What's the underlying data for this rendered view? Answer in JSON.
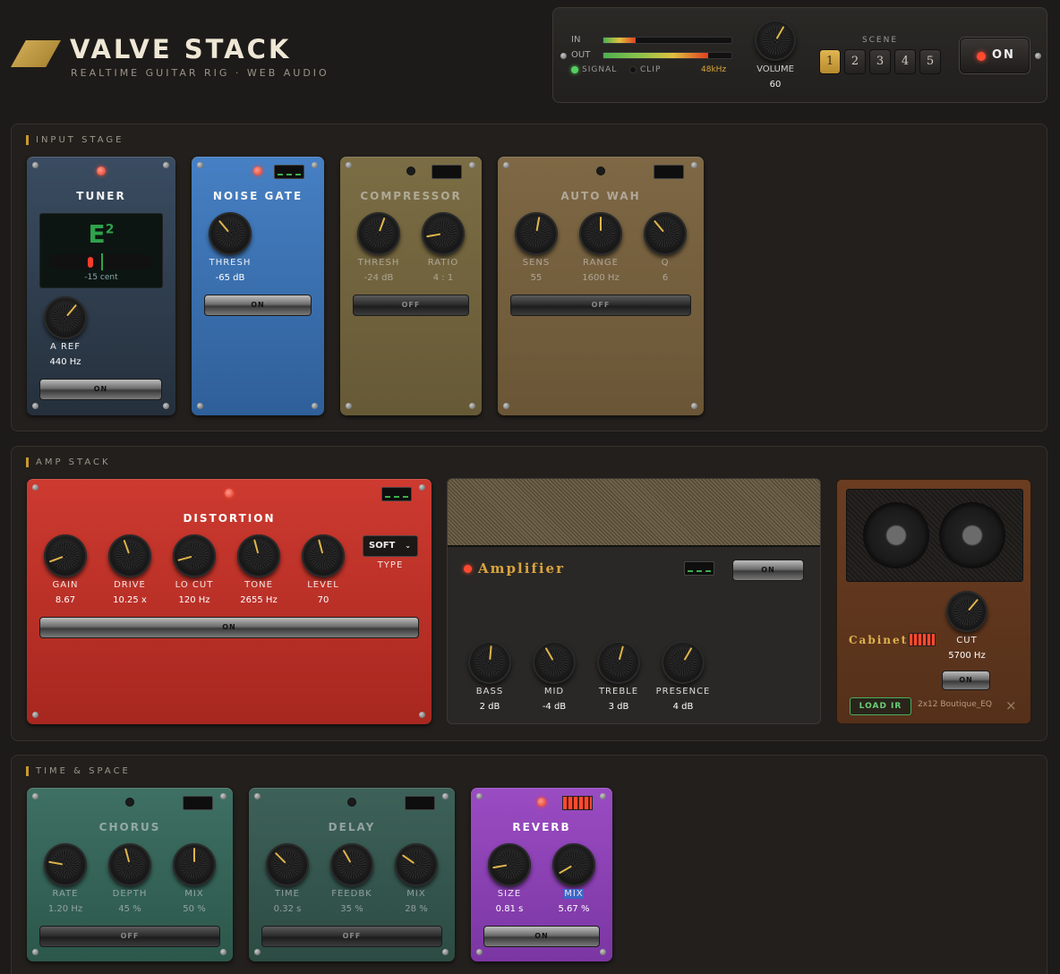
{
  "app": {
    "title": "VALVE STACK",
    "subtitle": "REALTIME GUITAR RIG · WEB AUDIO"
  },
  "master": {
    "in_label": "IN",
    "out_label": "OUT",
    "signal_label": "SIGNAL",
    "clip_label": "CLIP",
    "sample_rate": "48kHz",
    "volume_label": "VOLUME",
    "volume_value": "60",
    "volume": 0.6,
    "scene_label": "SCENE",
    "scenes": [
      "1",
      "2",
      "3",
      "4",
      "5"
    ],
    "active_scene": "1",
    "power_label": "ON",
    "in_level": 0.25,
    "out_level": 0.8
  },
  "sections": {
    "input": "INPUT STAGE",
    "amp": "AMP STACK",
    "time": "TIME & SPACE"
  },
  "tuner": {
    "title": "TUNER",
    "note": "E",
    "octave": "2",
    "cents": "-15 cent",
    "knob_label": "A REF",
    "knob_value": "440 Hz",
    "switch": "ON"
  },
  "noise_gate": {
    "title": "NOISE GATE",
    "knob_label": "THRESH",
    "knob_value": "-65 dB",
    "switch": "ON"
  },
  "compressor": {
    "title": "COMPRESSOR",
    "k1_label": "THRESH",
    "k1_value": "-24 dB",
    "k2_label": "RATIO",
    "k2_value": "4 : 1",
    "switch": "OFF"
  },
  "auto_wah": {
    "title": "AUTO WAH",
    "k1_label": "SENS",
    "k1_value": "55",
    "k2_label": "RANGE",
    "k2_value": "1600 Hz",
    "k3_label": "Q",
    "k3_value": "6",
    "switch": "OFF"
  },
  "distortion": {
    "title": "DISTORTION",
    "type_value": "SOFT",
    "type_label": "TYPE",
    "k1_label": "GAIN",
    "k1_value": "8.67",
    "k2_label": "DRIVE",
    "k2_value": "10.25 x",
    "k3_label": "LO CUT",
    "k3_value": "120 Hz",
    "k4_label": "TONE",
    "k4_value": "2655 Hz",
    "k5_label": "LEVEL",
    "k5_value": "70",
    "switch": "ON"
  },
  "amplifier": {
    "title": "Amplifier",
    "switch": "ON",
    "k1_label": "BASS",
    "k1_value": "2 dB",
    "k2_label": "MID",
    "k2_value": "-4 dB",
    "k3_label": "TREBLE",
    "k3_value": "3 dB",
    "k4_label": "PRESENCE",
    "k4_value": "4 dB"
  },
  "cabinet": {
    "title": "Cabinet",
    "knob_label": "CUT",
    "knob_value": "5700 Hz",
    "switch": "ON",
    "load_label": "LOAD IR",
    "ir_name": "2x12 Boutique_EQ",
    "close": "×"
  },
  "chorus": {
    "title": "CHORUS",
    "k1_label": "RATE",
    "k1_value": "1.20 Hz",
    "k2_label": "DEPTH",
    "k2_value": "45 %",
    "k3_label": "MIX",
    "k3_value": "50 %",
    "switch": "OFF"
  },
  "delay": {
    "title": "DELAY",
    "k1_label": "TIME",
    "k1_value": "0.32 s",
    "k2_label": "FEEDBK",
    "k2_value": "35 %",
    "k3_label": "MIX",
    "k3_value": "28 %",
    "switch": "OFF"
  },
  "reverb": {
    "title": "REVERB",
    "k1_label": "SIZE",
    "k1_value": "0.81 s",
    "k2_label": "MIX",
    "k2_value": "5.67 %",
    "switch": "ON"
  }
}
